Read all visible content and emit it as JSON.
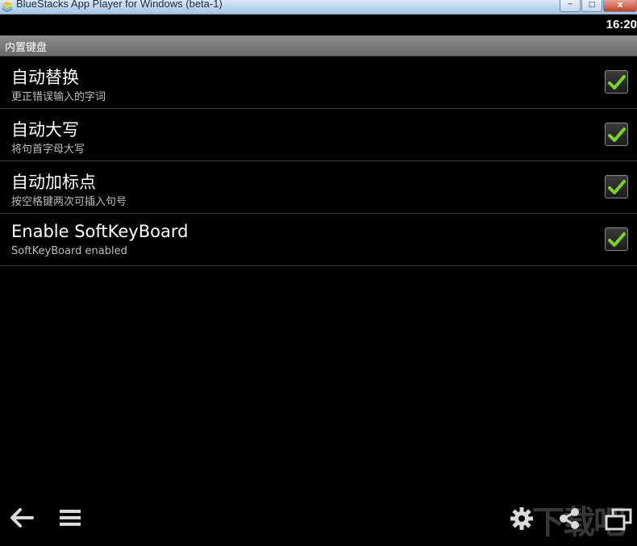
{
  "window": {
    "title": "BlueStacks App Player for Windows (beta-1)",
    "minimize_label": "─",
    "maximize_label": "□",
    "close_label": "x"
  },
  "status": {
    "time": "16:20"
  },
  "header": {
    "title": "内置键盘"
  },
  "prefs": [
    {
      "title": "自动替换",
      "summary": "更正错误输入的字词",
      "checked": true
    },
    {
      "title": "自动大写",
      "summary": "将句首字母大写",
      "checked": true
    },
    {
      "title": "自动加标点",
      "summary": "按空格键两次可插入句号",
      "checked": true
    },
    {
      "title": "Enable SoftKeyBoard",
      "summary": "SoftKeyBoard enabled",
      "checked": true
    }
  ],
  "nav": {
    "icons": [
      "back-icon",
      "menu-icon",
      "settings-icon",
      "share-icon",
      "fullscreen-icon"
    ]
  },
  "watermark": "下载吧",
  "colors": {
    "check": "#7ed321",
    "header": "#7a7a7a",
    "background": "#000000"
  }
}
